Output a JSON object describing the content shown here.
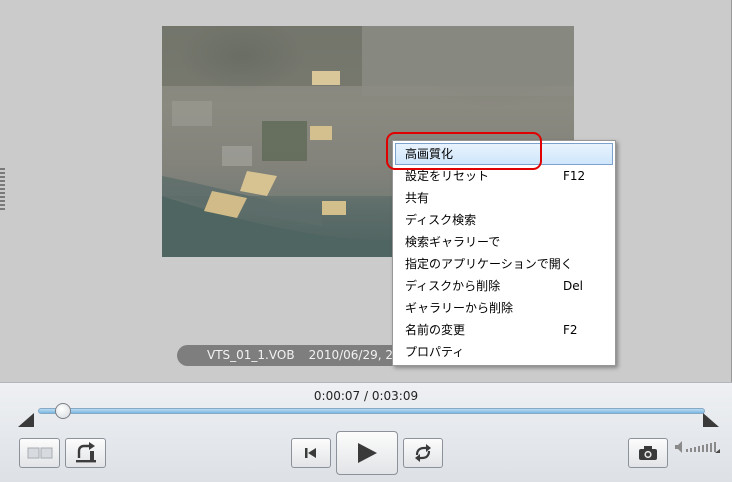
{
  "player": {
    "filename": "VTS_01_1.VOB",
    "datetime": "2010/06/29, 23:"
  },
  "context_menu": {
    "items": [
      {
        "label": "高画質化",
        "shortcut": "",
        "highlighted": true
      },
      {
        "label": "設定をリセット",
        "shortcut": "F12"
      },
      {
        "label": "共有",
        "shortcut": ""
      },
      {
        "label": "ディスク検索",
        "shortcut": ""
      },
      {
        "label": "検索ギャラリーで",
        "shortcut": ""
      },
      {
        "label": "指定のアプリケーションで開く",
        "shortcut": ""
      },
      {
        "label": "ディスクから削除",
        "shortcut": "Del"
      },
      {
        "label": "ギャラリーから削除",
        "shortcut": ""
      },
      {
        "label": "名前の変更",
        "shortcut": "F2"
      },
      {
        "label": "プロパティ",
        "shortcut": ""
      }
    ]
  },
  "playback": {
    "time_display": "0:00:07 / 0:03:09",
    "progress_fraction": 0.037
  },
  "colors": {
    "highlight_annotation": "#e00000",
    "seek_fill": "#7ab8e0"
  },
  "icons": {
    "view_toggle": "compare-view-icon",
    "rotate": "rotate-icon",
    "previous": "skip-previous-icon",
    "play": "play-icon",
    "repeat": "repeat-icon",
    "snapshot": "camera-icon",
    "volume": "volume-icon"
  }
}
